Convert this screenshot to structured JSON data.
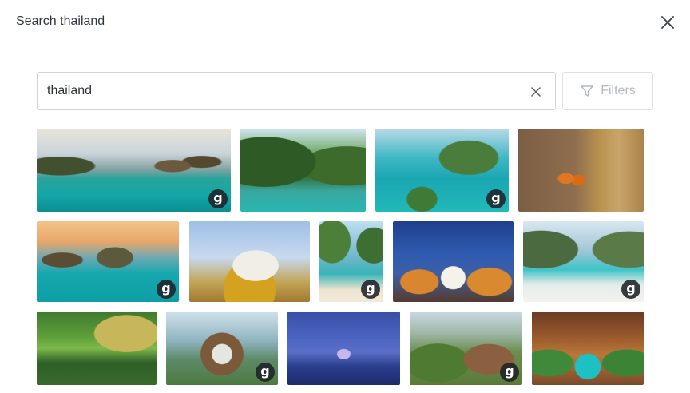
{
  "header": {
    "title": "Search thailand"
  },
  "search": {
    "value": "thailand",
    "filters_label": "Filters"
  },
  "icons": {
    "close": "close-icon",
    "clear": "clear-icon",
    "filter": "filter-icon",
    "source_badge": "g"
  },
  "colors": {
    "border": "#cfd3d8",
    "disabled_text": "#b4b8be",
    "badge_bg": "#1e2228"
  },
  "results": [
    {
      "badge": "g"
    },
    {
      "badge": ""
    },
    {
      "badge": "g"
    },
    {
      "badge": ""
    },
    {
      "badge": "g"
    },
    {
      "badge": ""
    },
    {
      "badge": "g"
    },
    {
      "badge": ""
    },
    {
      "badge": "g"
    },
    {
      "badge": ""
    },
    {
      "badge": "g"
    },
    {
      "badge": ""
    },
    {
      "badge": "g"
    },
    {
      "badge": ""
    }
  ]
}
